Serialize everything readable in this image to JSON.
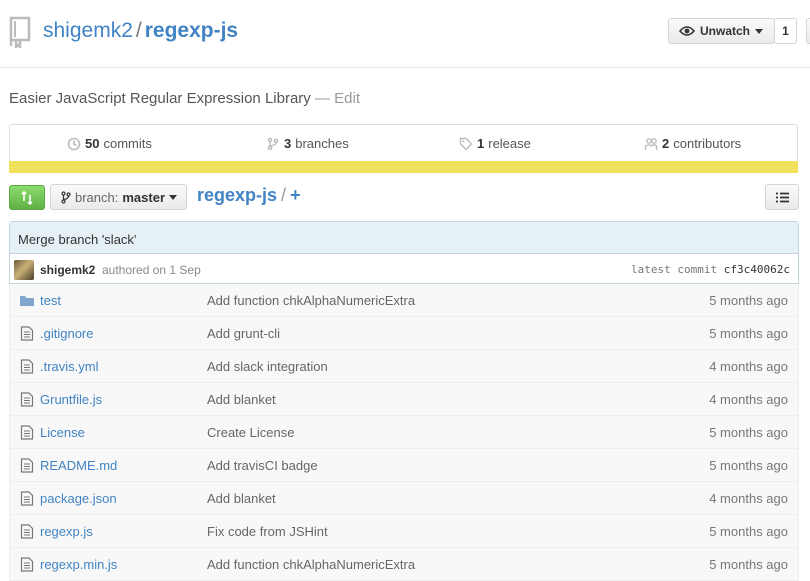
{
  "repo": {
    "owner": "shigemk2",
    "separator": "/",
    "name": "regexp-js"
  },
  "watch": {
    "label": "Unwatch",
    "count": "1"
  },
  "description": {
    "text": "Easier JavaScript Regular Expression Library",
    "dash": " — ",
    "edit_label": "Edit"
  },
  "summary": {
    "commits": {
      "count": "50",
      "label": "commits"
    },
    "branches": {
      "count": "3",
      "label": "branches"
    },
    "releases": {
      "count": "1",
      "label": "release"
    },
    "contributors": {
      "count": "2",
      "label": "contributors"
    },
    "language_color": "#f1e05a"
  },
  "filenav": {
    "branch_label": "branch:",
    "branch_value": "master",
    "breadcrumb_repo": "regexp-js",
    "breadcrumb_sep": "/",
    "add_label": "+"
  },
  "commit": {
    "message": "Merge branch 'slack'",
    "author": "shigemk2",
    "authored": "authored on 1 Sep",
    "latest_label": "latest commit",
    "sha": "cf3c40062c"
  },
  "files": [
    {
      "type": "folder",
      "name": "test",
      "message": "Add function chkAlphaNumericExtra",
      "age": "5 months ago"
    },
    {
      "type": "file",
      "name": ".gitignore",
      "message": "Add grunt-cli",
      "age": "5 months ago"
    },
    {
      "type": "file",
      "name": ".travis.yml",
      "message": "Add slack integration",
      "age": "4 months ago"
    },
    {
      "type": "file",
      "name": "Gruntfile.js",
      "message": "Add blanket",
      "age": "4 months ago"
    },
    {
      "type": "file",
      "name": "License",
      "message": "Create License",
      "age": "5 months ago"
    },
    {
      "type": "file",
      "name": "README.md",
      "message": "Add travisCI badge",
      "age": "5 months ago"
    },
    {
      "type": "file",
      "name": "package.json",
      "message": "Add blanket",
      "age": "4 months ago"
    },
    {
      "type": "file",
      "name": "regexp.js",
      "message": "Fix code from JSHint",
      "age": "5 months ago"
    },
    {
      "type": "file",
      "name": "regexp.min.js",
      "message": "Add function chkAlphaNumericExtra",
      "age": "5 months ago"
    }
  ]
}
